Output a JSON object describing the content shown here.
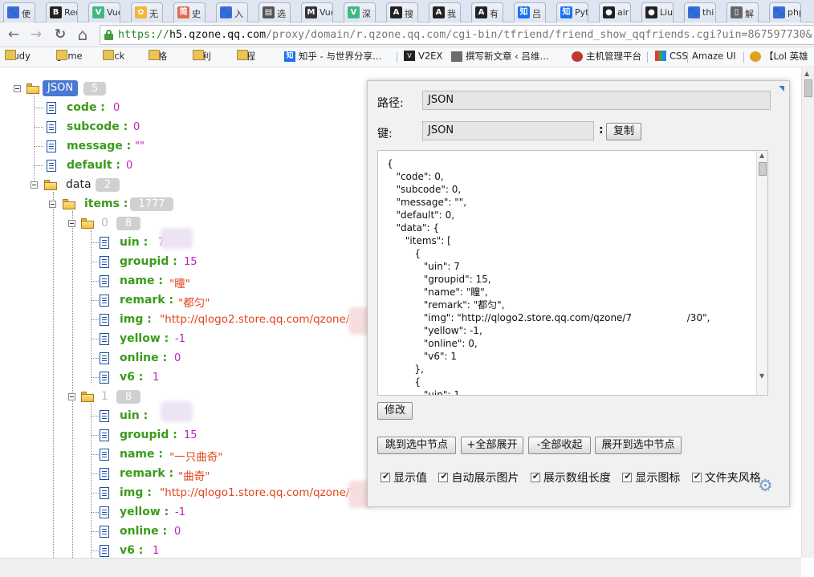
{
  "browser": {
    "tabs": [
      {
        "label": "使",
        "icon": "paw-icon",
        "color": "#3a6bd8"
      },
      {
        "label": "Red",
        "icon": "b-logo-icon",
        "color": "#222222"
      },
      {
        "label": "Vue",
        "icon": "vue-icon",
        "color": "#41b883"
      },
      {
        "label": "无",
        "icon": "colorful-icon",
        "color": "#f2b53a"
      },
      {
        "label": "史",
        "icon": "jian-icon",
        "color": "#e06a4e"
      },
      {
        "label": "入",
        "icon": "paw-icon",
        "color": "#3a6bd8"
      },
      {
        "label": "选",
        "icon": "table-icon",
        "color": "#555555"
      },
      {
        "label": "Vue",
        "icon": "m-icon",
        "color": "#333333"
      },
      {
        "label": "深",
        "icon": "v-icon",
        "color": "#41b883"
      },
      {
        "label": "搜",
        "icon": "doc-icon",
        "color": "#222222"
      },
      {
        "label": "我",
        "icon": "doc-icon",
        "color": "#222222"
      },
      {
        "label": "有",
        "icon": "doc-icon",
        "color": "#222222"
      },
      {
        "label": "吕",
        "icon": "zhihu-icon",
        "color": "#1772f6"
      },
      {
        "label": "Pyt",
        "icon": "zhihu-icon",
        "color": "#1772f6"
      },
      {
        "label": "air",
        "icon": "github-icon",
        "color": "#222222"
      },
      {
        "label": "Liu",
        "icon": "github-icon",
        "color": "#222222"
      },
      {
        "label": "thi",
        "icon": "paw-icon",
        "color": "#3a6bd8"
      },
      {
        "label": "解",
        "icon": "page-icon",
        "color": "#666666"
      },
      {
        "label": "php",
        "icon": "paw-icon",
        "color": "#3a6bd8"
      }
    ],
    "nav": {
      "back": "←",
      "forward": "→",
      "reload": "↻",
      "home": "⌂"
    },
    "url": {
      "scheme": "https://",
      "host": "h5.qzone.qq.com",
      "path": "/proxy/domain/r.qzone.qq.com/cgi-bin/tfriend/friend_show_qqfriends.cgi?uin=867597730&"
    },
    "bookmarks": [
      {
        "label": "study",
        "icon": "folder"
      },
      {
        "label": "game",
        "icon": "folder"
      },
      {
        "label": "hack",
        "icon": "folder"
      },
      {
        "label": "逼格",
        "icon": "folder"
      },
      {
        "label": "福利",
        "icon": "folder"
      },
      {
        "label": "编程",
        "icon": "folder"
      },
      {
        "label": "知乎 - 与世界分享…",
        "icon": "zhi"
      },
      {
        "label": "V2EX",
        "icon": "v2"
      },
      {
        "label": "撰写新文章 ‹ 吕维…",
        "icon": "sq"
      },
      {
        "label": "主机管理平台",
        "icon": "host"
      },
      {
        "label": "CSS",
        "icon": "css"
      },
      {
        "label": "Amaze UI",
        "icon": ""
      },
      {
        "label": "【Lol 英雄",
        "icon": "lol"
      }
    ]
  },
  "tree": {
    "root": {
      "label": "JSON",
      "count": "5"
    },
    "code": {
      "key": "code :",
      "value": "0"
    },
    "subcode": {
      "key": "subcode :",
      "value": "0"
    },
    "message": {
      "key": "message :",
      "value": "\"\""
    },
    "default": {
      "key": "default :",
      "value": "0"
    },
    "data": {
      "label": "data",
      "count": "2"
    },
    "items": {
      "key": "items :",
      "count": "1777"
    },
    "item0": {
      "index": "0",
      "count": "8",
      "uin": {
        "key": "uin :",
        "value": "7"
      },
      "groupid": {
        "key": "groupid :",
        "value": "15"
      },
      "name": {
        "key": "name :",
        "value": "\"瞳\""
      },
      "remark": {
        "key": "remark :",
        "value": "\"都匀\""
      },
      "img": {
        "key": "img :",
        "value": "\"http://qlogo2.store.qq.com/qzone/79"
      },
      "yellow": {
        "key": "yellow :",
        "value": "-1"
      },
      "online": {
        "key": "online :",
        "value": "0"
      },
      "v6": {
        "key": "v6 :",
        "value": "1"
      }
    },
    "item1": {
      "index": "1",
      "count": "8",
      "uin": {
        "key": "uin :",
        "value": ""
      },
      "groupid": {
        "key": "groupid :",
        "value": "15"
      },
      "name": {
        "key": "name :",
        "value": "\"一只曲奇\""
      },
      "remark": {
        "key": "remark :",
        "value": "\"曲奇\""
      },
      "img": {
        "key": "img :",
        "value": "\"http://qlogo1.store.qq.com/qzone/79"
      },
      "yellow": {
        "key": "yellow :",
        "value": "-1"
      },
      "online": {
        "key": "online :",
        "value": "0"
      },
      "v6": {
        "key": "v6 :",
        "value": "1"
      }
    }
  },
  "panel": {
    "path_label": "路径:",
    "path_value": "JSON",
    "key_label": "键:",
    "key_value": "JSON",
    "key_colon": ":",
    "copy_button": "复制",
    "code": "{\n   \"code\": 0,\n   \"subcode\": 0,\n   \"message\": \"\",\n   \"default\": 0,\n   \"data\": {\n      \"items\": [\n         {\n            \"uin\": 7\n            \"groupid\": 15,\n            \"name\": \"瞳\",\n            \"remark\": \"都匀\",\n            \"img\": \"http://qlogo2.store.qq.com/qzone/7                  /30\",\n            \"yellow\": -1,\n            \"online\": 0,\n            \"v6\": 1\n         },\n         {\n            \"uin\": 1",
    "modify_button": "修改",
    "action_buttons": [
      "跳到选中节点",
      "+全部展开",
      "-全部收起",
      "展开到选中节点"
    ],
    "checkboxes": [
      "显示值",
      "自动展示图片",
      "展示数组长度",
      "显示图标",
      "文件夹风格"
    ]
  }
}
